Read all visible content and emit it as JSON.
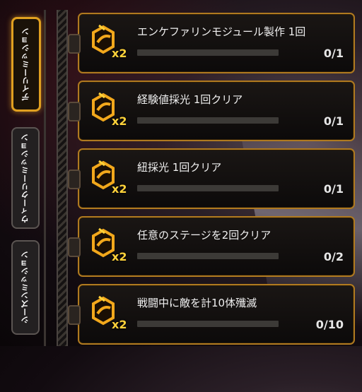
{
  "tabs": [
    {
      "label": "デイリーミッション",
      "active": true
    },
    {
      "label": "ウィークリーミッション",
      "active": false
    },
    {
      "label": "シーズンミッション",
      "active": false
    }
  ],
  "missions": [
    {
      "title": "エンケファリンモジュール製作 1回",
      "reward_multiplier": "x2",
      "progress_text": "0/1",
      "progress": 0
    },
    {
      "title": "経験値採光 1回クリア",
      "reward_multiplier": "x2",
      "progress_text": "0/1",
      "progress": 0
    },
    {
      "title": "紐採光 1回クリア",
      "reward_multiplier": "x2",
      "progress_text": "0/1",
      "progress": 0
    },
    {
      "title": "任意のステージを2回クリア",
      "reward_multiplier": "x2",
      "progress_text": "0/2",
      "progress": 0
    },
    {
      "title": "戦闘中に敵を計10体殲滅",
      "reward_multiplier": "x2",
      "progress_text": "0/10",
      "progress": 0
    }
  ],
  "colors": {
    "accent": "#e0a020",
    "card_border": "#b07a20",
    "icon": "#f2a81c"
  },
  "icons": {
    "reward": "enkephalin-token-icon"
  }
}
